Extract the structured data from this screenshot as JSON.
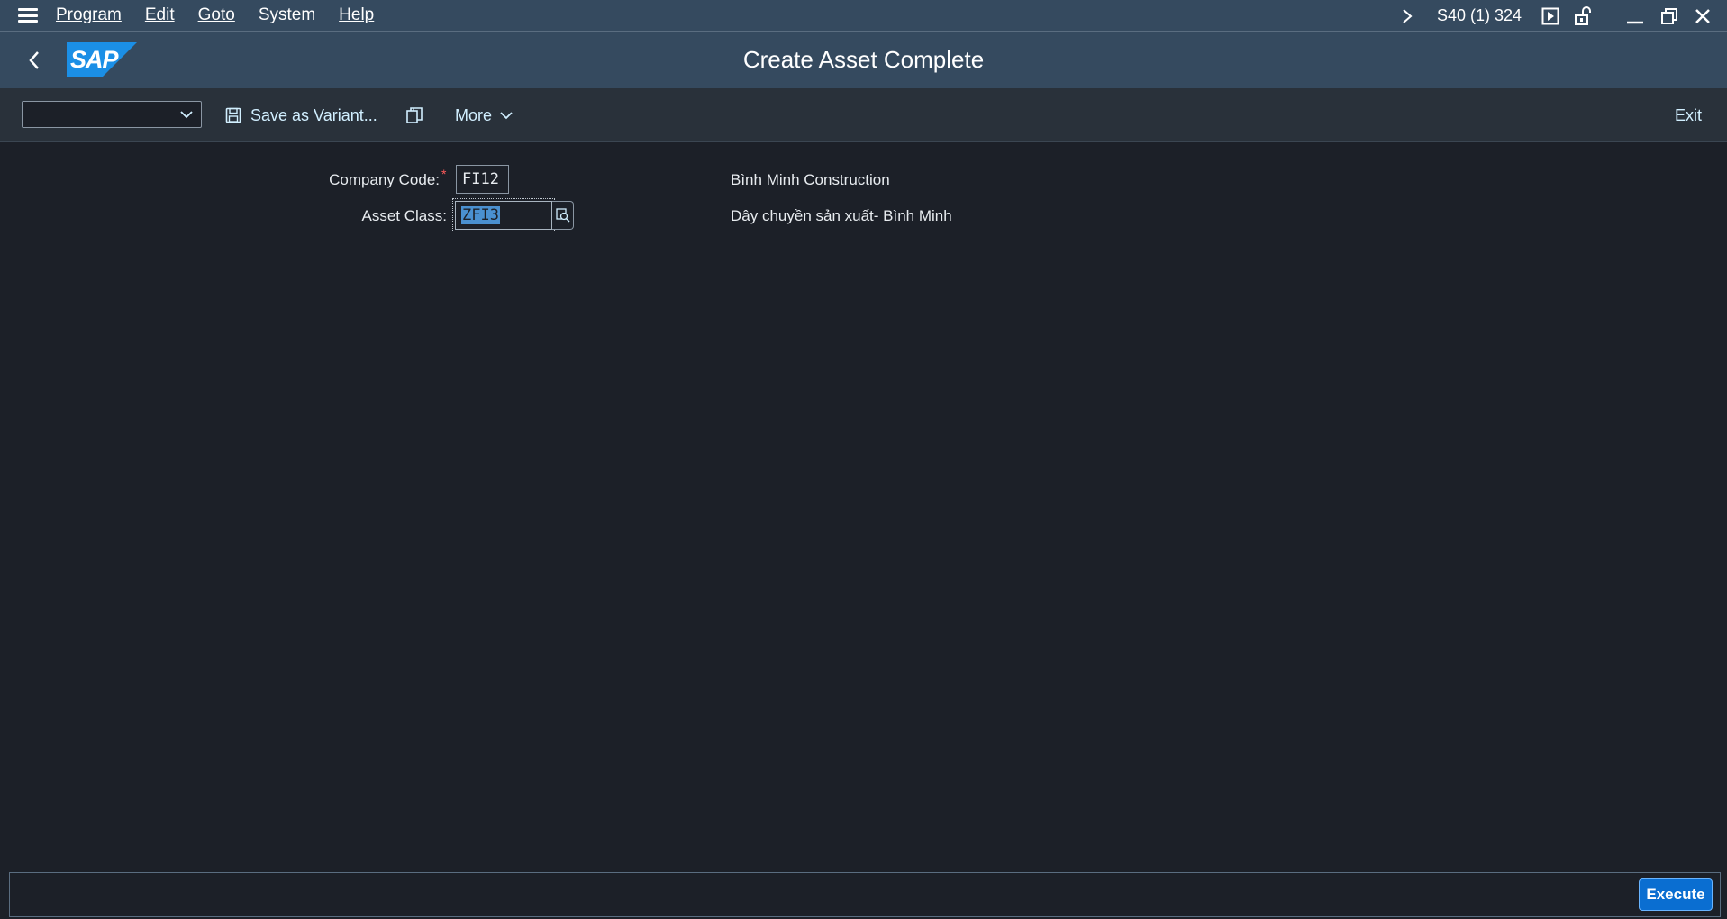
{
  "menubar": {
    "items": [
      {
        "label": "Program"
      },
      {
        "label": "Edit"
      },
      {
        "label": "Goto"
      },
      {
        "label": "System"
      },
      {
        "label": "Help"
      }
    ],
    "system_info": "S40 (1) 324"
  },
  "shell": {
    "logo_text": "SAP",
    "title": "Create Asset Complete"
  },
  "toolbar": {
    "variant_value": "",
    "save_variant_label": "Save as Variant...",
    "more_label": "More",
    "exit_label": "Exit"
  },
  "form": {
    "company_code": {
      "label": "Company Code:",
      "required_mark": "*",
      "value": "FI12",
      "description": "Bình Minh Construction"
    },
    "asset_class": {
      "label": "Asset Class:",
      "value": "ZFI3",
      "description": "Dây chuyền sản xuất- Bình Minh"
    }
  },
  "footer": {
    "execute_label": "Execute"
  },
  "colors": {
    "shell": "#354a5f",
    "background": "#1c2028",
    "toolbar": "#29313a",
    "accent": "#0a6ed1",
    "link": "#d1efff"
  }
}
